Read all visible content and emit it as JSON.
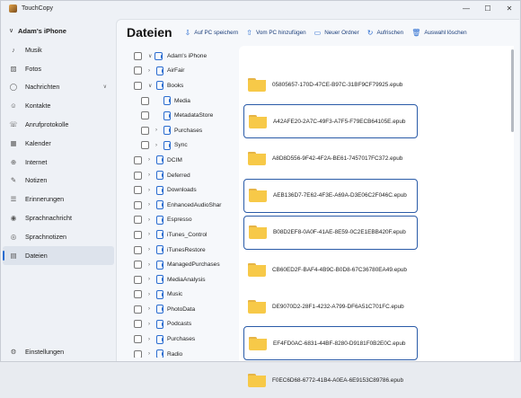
{
  "app": {
    "title": "TouchCopy"
  },
  "window_controls": {
    "minimize": "—",
    "maximize": "☐",
    "close": "✕"
  },
  "sidebar": {
    "device_name": "Adam's iPhone",
    "items": [
      {
        "label": "Musik",
        "icon": "music-note-icon",
        "glyph": "♪"
      },
      {
        "label": "Fotos",
        "icon": "photo-icon",
        "glyph": "▨"
      },
      {
        "label": "Nachrichten",
        "icon": "message-icon",
        "glyph": "◯",
        "expandable": "∨"
      },
      {
        "label": "Kontakte",
        "icon": "contacts-icon",
        "glyph": "☺"
      },
      {
        "label": "Anrufprotokolle",
        "icon": "call-log-icon",
        "glyph": "☏"
      },
      {
        "label": "Kalender",
        "icon": "calendar-icon",
        "glyph": "▦"
      },
      {
        "label": "Internet",
        "icon": "globe-icon",
        "glyph": "⊕"
      },
      {
        "label": "Notizen",
        "icon": "notes-icon",
        "glyph": "✎"
      },
      {
        "label": "Erinnerungen",
        "icon": "reminders-icon",
        "glyph": "☰"
      },
      {
        "label": "Sprachnachricht",
        "icon": "voicemail-icon",
        "glyph": "◉"
      },
      {
        "label": "Sprachnotizen",
        "icon": "voice-memo-icon",
        "glyph": "◎"
      },
      {
        "label": "Dateien",
        "icon": "files-icon",
        "glyph": "▤"
      }
    ],
    "active_index": 11,
    "settings_label": "Einstellungen"
  },
  "main": {
    "title": "Dateien",
    "toolbar": [
      {
        "label": "Auf PC speichern",
        "icon": "save-to-pc-icon",
        "glyph": "⇩"
      },
      {
        "label": "Vom PC hinzufügen",
        "icon": "add-from-pc-icon",
        "glyph": "⇧"
      },
      {
        "label": "Neuer Ordner",
        "icon": "new-folder-icon",
        "glyph": "▭"
      },
      {
        "label": "Aufrischen",
        "icon": "refresh-icon",
        "glyph": "↻"
      },
      {
        "label": "Auswahl löschen",
        "icon": "delete-icon",
        "glyph": "🗑"
      }
    ]
  },
  "tree": {
    "root": "Adam's iPhone",
    "nodes": [
      {
        "label": "AirFair",
        "depth": 1,
        "expandable": true
      },
      {
        "label": "Books",
        "depth": 1,
        "expandable": true,
        "expanded": true
      },
      {
        "label": "Media",
        "depth": 2,
        "expandable": false
      },
      {
        "label": "MetadataStore",
        "depth": 2,
        "expandable": false
      },
      {
        "label": "Purchases",
        "depth": 2,
        "expandable": true
      },
      {
        "label": "Sync",
        "depth": 2,
        "expandable": true
      },
      {
        "label": "DCIM",
        "depth": 1,
        "expandable": true
      },
      {
        "label": "Deferred",
        "depth": 1,
        "expandable": true
      },
      {
        "label": "Downloads",
        "depth": 1,
        "expandable": true
      },
      {
        "label": "EnhancedAudioShar",
        "depth": 1,
        "expandable": true
      },
      {
        "label": "Espresso",
        "depth": 1,
        "expandable": true
      },
      {
        "label": "iTunes_Control",
        "depth": 1,
        "expandable": true
      },
      {
        "label": "iTunesRestore",
        "depth": 1,
        "expandable": true
      },
      {
        "label": "ManagedPurchases",
        "depth": 1,
        "expandable": true
      },
      {
        "label": "MediaAnalysis",
        "depth": 1,
        "expandable": true
      },
      {
        "label": "Music",
        "depth": 1,
        "expandable": true
      },
      {
        "label": "PhotoData",
        "depth": 1,
        "expandable": true
      },
      {
        "label": "Podcasts",
        "depth": 1,
        "expandable": true
      },
      {
        "label": "Purchases",
        "depth": 1,
        "expandable": true
      },
      {
        "label": "Radio",
        "depth": 1,
        "expandable": true
      }
    ]
  },
  "files": [
    {
      "name": "05805657-170D-47CE-B97C-31BF9CF79925.epub",
      "selected": false
    },
    {
      "name": "A42AFE20-2A7C-49F3-A7F5-F79ECB64105E.epub",
      "selected": true
    },
    {
      "name": "A8D8D556-9F42-4F2A-BE61-7457017FC372.epub",
      "selected": false
    },
    {
      "name": "AEB136D7-7E62-4F3E-A69A-D3E06C2F046C.epub",
      "selected": true
    },
    {
      "name": "B08D2EF8-0A0F-41AE-8E59-0C2E1EBB420F.epub",
      "selected": true
    },
    {
      "name": "CB60ED2F-BAF4-4B9C-B0D8-67C36780EA49.epub",
      "selected": false
    },
    {
      "name": "DE9070D2-28F1-4232-A799-DF6A51C701FC.epub",
      "selected": false
    },
    {
      "name": "EF4FD0AC-6831-44BF-8280-D9181F0B2E0C.epub",
      "selected": true
    },
    {
      "name": "F0EC6D68-6772-41B4-A0EA-6E9153C89786.epub",
      "selected": false
    }
  ]
}
